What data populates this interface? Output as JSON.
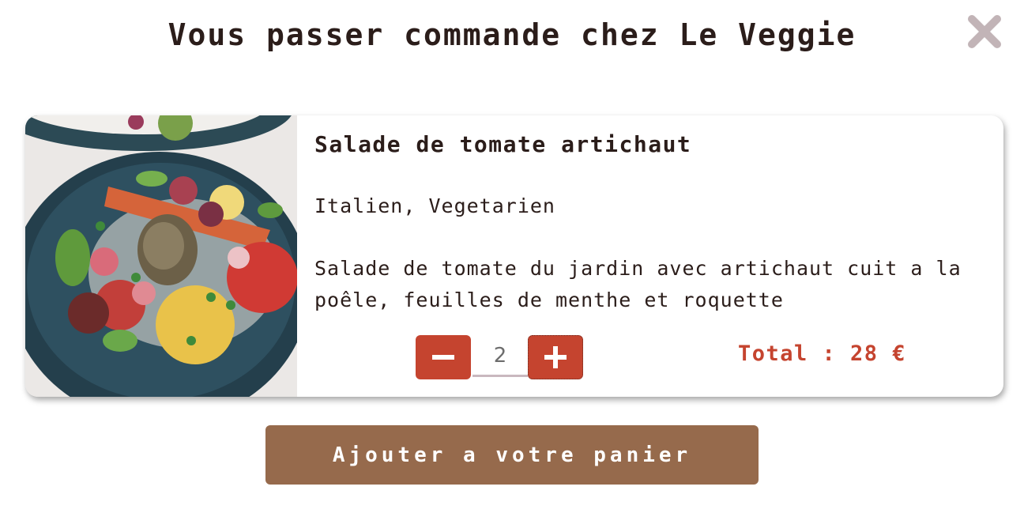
{
  "modal": {
    "title": "Vous passer commande chez Le Veggie",
    "close_icon": "close-icon"
  },
  "dish": {
    "name": "Salade de tomate artichaut",
    "tags": "Italien, Vegetarien",
    "description": "Salade de tomate du jardin avec artichaut cuit a la poêle, feuilles de menthe et roquette",
    "image_icon": "dish-photo"
  },
  "quantity": {
    "value": "2",
    "minus_icon": "minus-icon",
    "plus_icon": "plus-icon"
  },
  "total": {
    "label": "Total : 28 €"
  },
  "actions": {
    "add_to_cart_label": "Ajouter a votre panier"
  },
  "colors": {
    "accent_red": "#c5442f",
    "button_brown": "#966a4c",
    "close_gray": "#c2b4b7",
    "text_dark": "#2b1d1a"
  }
}
